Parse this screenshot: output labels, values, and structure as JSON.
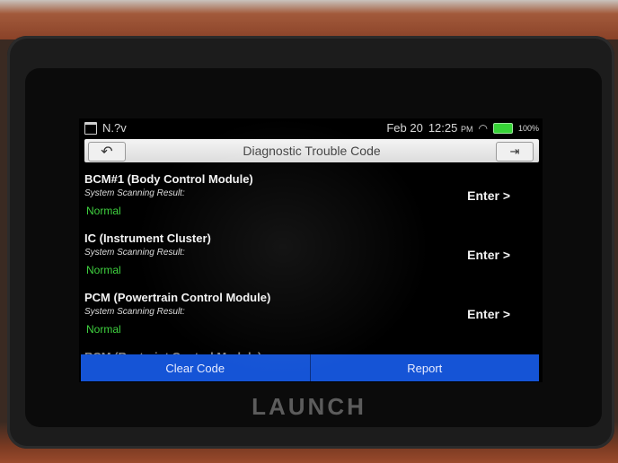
{
  "device": {
    "brand": "LAUNCH"
  },
  "statusbar": {
    "left_text": "N.?v",
    "date": "Feb 20",
    "time": "12:25",
    "ampm": "PM",
    "battery": "100%"
  },
  "titlebar": {
    "title": "Diagnostic Trouble Code",
    "back_icon": "↶",
    "exit_icon": "⇥"
  },
  "modules": [
    {
      "name": "BCM#1 (Body Control Module)",
      "sub": "System Scanning Result:",
      "result": "Normal",
      "enter": "Enter >"
    },
    {
      "name": "IC (Instrument Cluster)",
      "sub": "System Scanning Result:",
      "result": "Normal",
      "enter": "Enter >"
    },
    {
      "name": "PCM (Powertrain Control Module)",
      "sub": "System Scanning Result:",
      "result": "Normal",
      "enter": "Enter >"
    }
  ],
  "partial_item": "RCM (Restraint Control Module)",
  "buttons": {
    "clear_code": "Clear Code",
    "report": "Report"
  },
  "colors": {
    "result_green": "#3fd13f",
    "button_blue": "#1554d6"
  }
}
